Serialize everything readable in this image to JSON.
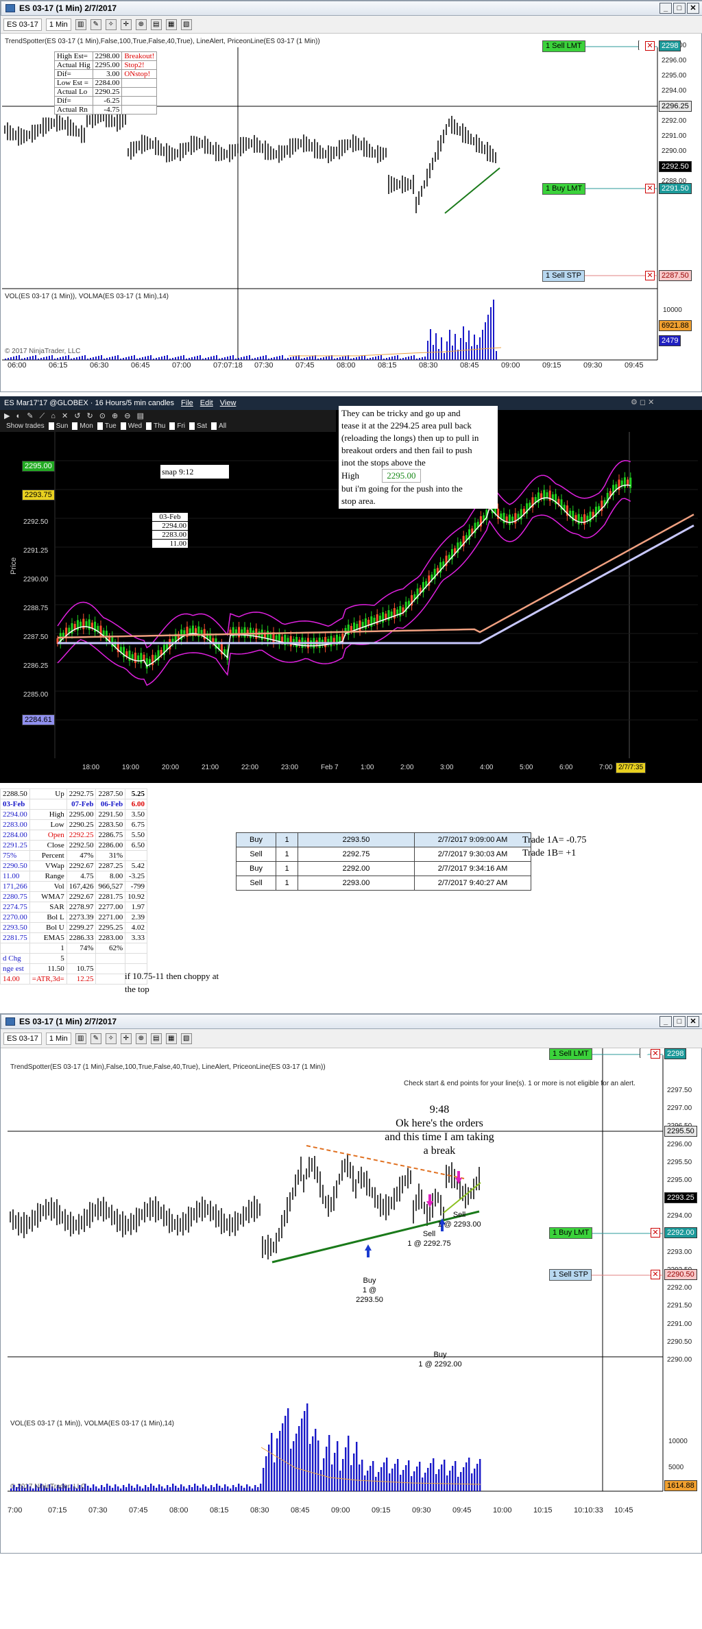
{
  "chart1": {
    "title": "ES 03-17 (1 Min)  2/7/2017",
    "toolbar": {
      "instrument": "ES 03-17",
      "interval": "1 Min"
    },
    "indicator_line": "TrendSpotter(ES 03-17 (1 Min),False,100,True,False,40,True), LineAlert, PriceonLine(ES 03-17 (1 Min))",
    "info_table": [
      [
        "High Est=",
        "2298.00",
        "Breakout!"
      ],
      [
        "Actual Hig",
        "2295.00",
        "Stop2!"
      ],
      [
        "Dif=",
        "3.00",
        "ONstop!"
      ],
      [
        "Low Est =",
        "2284.00",
        ""
      ],
      [
        "Actual Lo",
        "2290.25",
        ""
      ],
      [
        "Dif=",
        "-6.25",
        ""
      ],
      [
        "Actual Rn",
        "-4.75",
        ""
      ]
    ],
    "yticks": [
      "2297.00",
      "2296.00",
      "2295.00",
      "2294.00",
      "2293.00",
      "2292.00",
      "2291.00",
      "2290.00",
      "2289.00",
      "2288.00"
    ],
    "xticks": [
      "06:00",
      "06:15",
      "06:30",
      "06:45",
      "07:00",
      "07:07:18",
      "07:30",
      "07:45",
      "08:00",
      "08:15",
      "08:30",
      "08:45",
      "09:00",
      "09:15",
      "09:30",
      "09:45"
    ],
    "orders": [
      {
        "label": "1 Sell LMT",
        "price": "2298"
      },
      {
        "label": "1 Buy LMT",
        "price": "2291.50"
      },
      {
        "label": "1 Sell STP",
        "price": "2287.50"
      }
    ],
    "last_price": "2292.50",
    "ref_price": "2296.25",
    "vol_label": "VOL(ES 03-17 (1 Min)), VOLMA(ES 03-17 (1 Min),14)",
    "vol_yticks": [
      "10000",
      "5000"
    ],
    "vol_tags": [
      "6921.88",
      "2479"
    ],
    "copyright": "© 2017 NinjaTrader, LLC"
  },
  "chart2": {
    "title": "ES Mar17'17 @GLOBEX  ·  16 Hours/5 min candles",
    "menu": [
      "File",
      "Edit",
      "View"
    ],
    "days": [
      "Show trades",
      "Sun",
      "Mon",
      "Tue",
      "Wed",
      "Thu",
      "Fri",
      "Sat",
      "All"
    ],
    "yticks": [
      "2295.00",
      "2293.75",
      "2292.50",
      "2291.25",
      "2290.00",
      "2288.75",
      "2287.50",
      "2286.25",
      "2285.00",
      "2283.75"
    ],
    "y_axis_title": "Price",
    "price_tag_green": "2295.00",
    "price_tag_yellow": "2293.75",
    "price_tag_blue": "2284.61",
    "xticks": [
      "18:00",
      "19:00",
      "20:00",
      "21:00",
      "22:00",
      "23:00",
      "Feb 7",
      "1:00",
      "2:00",
      "3:00",
      "4:00",
      "5:00",
      "6:00",
      "7:00"
    ],
    "time_tag": "2/7/7:35",
    "snap_label": "snap 9:12",
    "date_box": [
      "03-Feb",
      "2294.00",
      "2283.00",
      "11.00"
    ],
    "note": [
      "They can be tricky and go up and",
      "tease it at the 2294.25 area pull back",
      "(reloading the longs) then up to pull in",
      "breakout orders and then fail to push",
      "inot the stops above the"
    ],
    "note_high_label": "High",
    "note_high_value": "2295.00",
    "note_tail": [
      "but i'm going for the push into the",
      "stop area."
    ]
  },
  "stats": {
    "header": [
      "2288.50",
      "Up",
      "2292.75",
      "2287.50",
      "5.25"
    ],
    "subheader": [
      "03-Feb",
      "",
      "07-Feb",
      "06-Feb",
      "6.00"
    ],
    "rows": [
      [
        "2294.00",
        "High",
        "2295.00",
        "2291.50",
        "3.50"
      ],
      [
        "2283.00",
        "Low",
        "2290.25",
        "2283.50",
        "6.75"
      ],
      [
        "2284.00",
        "Open",
        "2292.25",
        "2286.75",
        "5.50"
      ],
      [
        "2291.25",
        "Close",
        "2292.50",
        "2286.00",
        "6.50"
      ],
      [
        "75%",
        "Percent",
        "47%",
        "31%",
        ""
      ],
      [
        "2290.50",
        "VWap",
        "2292.67",
        "2287.25",
        "5.42"
      ],
      [
        "11.00",
        "Range",
        "4.75",
        "8.00",
        "-3.25"
      ],
      [
        "171,266",
        "Vol",
        "167,426",
        "966,527",
        "-799"
      ],
      [
        "2280.75",
        "WMA7",
        "2292.67",
        "2281.75",
        "10.92"
      ],
      [
        "2274.75",
        "SAR",
        "2278.97",
        "2277.00",
        "1.97"
      ],
      [
        "2270.00",
        "Bol L",
        "2273.39",
        "2271.00",
        "2.39"
      ],
      [
        "2293.50",
        "Bol U",
        "2299.27",
        "2295.25",
        "4.02"
      ],
      [
        "2281.75",
        "EMA5",
        "2286.33",
        "2283.00",
        "3.33"
      ],
      [
        "",
        "1",
        "74%",
        "62%",
        ""
      ],
      [
        "d Chg",
        "5",
        "",
        "",
        ""
      ],
      [
        "nge est",
        "11.50",
        "10.75",
        "",
        ""
      ],
      [
        "14.00",
        "=ATR,3d=",
        "12.25",
        "",
        ""
      ]
    ],
    "note": [
      "if 10.75-11 then choppy at",
      "the top"
    ]
  },
  "trades": [
    [
      "Buy",
      "1",
      "2293.50",
      "2/7/2017 9:09:00 AM"
    ],
    [
      "Sell",
      "1",
      "2292.75",
      "2/7/2017 9:30:03 AM"
    ],
    [
      "Buy",
      "1",
      "2292.00",
      "2/7/2017 9:34:16 AM"
    ],
    [
      "Sell",
      "1",
      "2293.00",
      "2/7/2017 9:40:27 AM"
    ]
  ],
  "trade_summary": [
    "Trade 1A= -0.75",
    "Trade 1B= +1"
  ],
  "chart3": {
    "title": "ES 03-17 (1 Min)  2/7/2017",
    "toolbar": {
      "instrument": "ES 03-17",
      "interval": "1 Min"
    },
    "indicator_line": "TrendSpotter(ES 03-17 (1 Min),False,100,True,False,40,True), LineAlert, PriceonLine(ES 03-17 (1 Min))",
    "alert": "Check start & end points for your line(s). 1 or more is not eligible for an alert.",
    "comment": [
      "9:48",
      "Ok here's the orders",
      "and this time I am taking",
      "a break"
    ],
    "yticks": [
      "2297.50",
      "2297.00",
      "2296.50",
      "2296.00",
      "2295.50",
      "2295.00",
      "2294.50",
      "2294.00",
      "2293.50",
      "2293.00",
      "2292.50",
      "2292.00",
      "2291.50",
      "2291.00",
      "2290.50",
      "2290.00"
    ],
    "xticks": [
      "7:00",
      "07:15",
      "07:30",
      "07:45",
      "08:00",
      "08:15",
      "08:30",
      "08:45",
      "09:00",
      "09:15",
      "09:30",
      "09:45",
      "10:00",
      "10:15",
      "10:10:33",
      "10:45"
    ],
    "orders": [
      {
        "label": "1 Sell LMT",
        "price": "2298"
      },
      {
        "label": "1 Buy LMT",
        "price": "2292.00"
      },
      {
        "label": "1 Sell STP",
        "price": "2290.50"
      }
    ],
    "last_price": "2293.25",
    "ref_price": "2295.50",
    "executions": [
      {
        "side": "Buy",
        "text": "1 @ 2293.50"
      },
      {
        "side": "Sell",
        "text": "1 @ 2292.75"
      },
      {
        "side": "Sell",
        "text": "1 @ 2293.00"
      },
      {
        "side": "Buy",
        "text": "1 @ 2292.00"
      }
    ],
    "vol_label": "VOL(ES 03-17 (1 Min)), VOLMA(ES 03-17 (1 Min),14)",
    "vol_yticks": [
      "10000",
      "5000"
    ],
    "vol_tag": "1614.88",
    "copyright": "© 2017 NinjaTrader, LLC"
  }
}
